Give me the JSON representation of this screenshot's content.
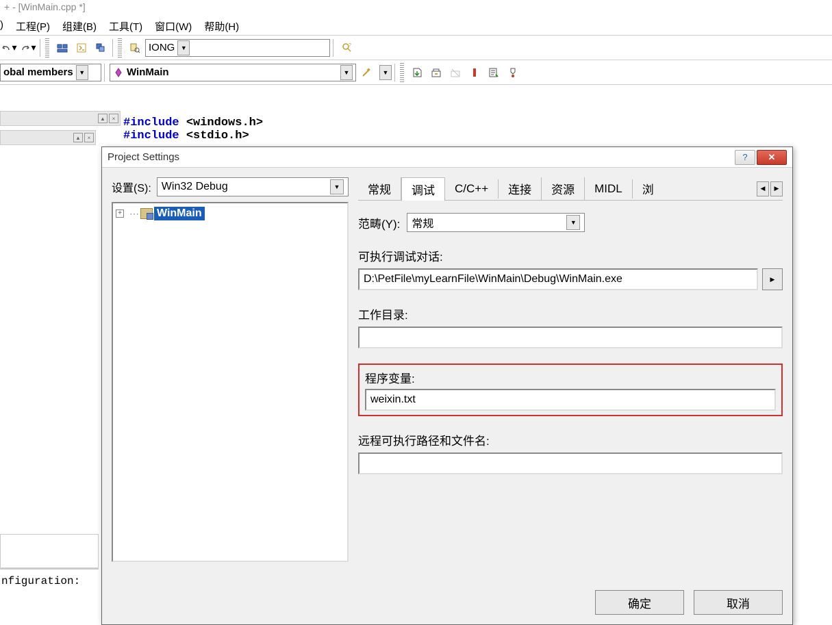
{
  "window_title": "+ - [WinMain.cpp *]",
  "menu": {
    "items": [
      "",
      "工程(P)",
      "组建(B)",
      "工具(T)",
      "窗口(W)",
      "帮助(H)"
    ],
    "first_partial": ")"
  },
  "toolbar1": {
    "combo_value": "IONG"
  },
  "toolbar2": {
    "combo1_label": "obal members",
    "combo2_value": "WinMain"
  },
  "code": {
    "line1_kw": "#include",
    "line1_rest": " <windows.h>",
    "line2_kw": "#include",
    "line2_rest": " <stdio.h>"
  },
  "bottom_text": "nfiguration:",
  "dialog": {
    "title": "Project Settings",
    "settings_label": "设置(S):",
    "settings_value": "Win32 Debug",
    "tree_item": "WinMain",
    "tabs": [
      "常规",
      "调试",
      "C/C++",
      "连接",
      "资源",
      "MIDL",
      "浏"
    ],
    "active_tab_index": 1,
    "category_label": "范畴(Y):",
    "category_value": "常规",
    "exe_label": "可执行调试对话:",
    "exe_value": "D:\\PetFile\\myLearnFile\\WinMain\\Debug\\WinMain.exe",
    "workdir_label": "工作目录:",
    "workdir_value": "",
    "args_label": "程序变量:",
    "args_value": "weixin.txt",
    "remote_label": "远程可执行路径和文件名:",
    "remote_value": "",
    "ok": "确定",
    "cancel": "取消"
  }
}
